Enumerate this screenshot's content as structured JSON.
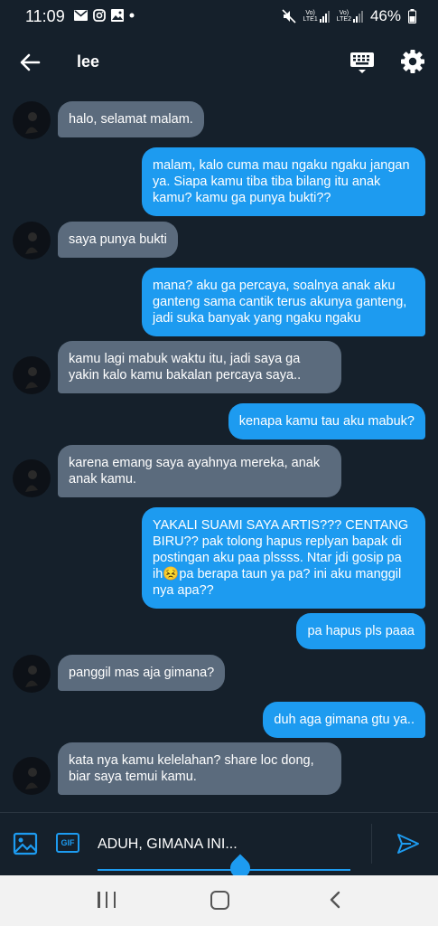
{
  "status_bar": {
    "time": "11:09",
    "lte1": "LTE1",
    "lte2": "LTE2",
    "volte1": "Vo)",
    "volte2": "Vo)",
    "battery": "46%"
  },
  "header": {
    "title": "lee"
  },
  "messages": [
    {
      "from": "them",
      "text": "halo, selamat malam."
    },
    {
      "from": "me",
      "text": "malam, kalo cuma mau ngaku ngaku jangan ya. Siapa kamu tiba tiba bilang itu anak kamu? kamu ga punya bukti??"
    },
    {
      "from": "them",
      "text": "saya punya bukti"
    },
    {
      "from": "me",
      "text": "mana? aku ga percaya, soalnya anak aku ganteng sama cantik terus akunya ganteng, jadi suka banyak yang ngaku ngaku"
    },
    {
      "from": "them",
      "text": "kamu lagi mabuk waktu itu, jadi saya ga yakin kalo kamu bakalan percaya saya.."
    },
    {
      "from": "me",
      "text": "kenapa kamu tau aku mabuk?"
    },
    {
      "from": "them",
      "text": "karena emang saya ayahnya mereka, anak anak kamu."
    },
    {
      "from": "me",
      "text": "YAKALI SUAMI SAYA ARTIS??? CENTANG BIRU?? pak tolong hapus replyan bapak di postingan aku paa plssss. Ntar jdi gosip pa ih😣pa berapa taun ya pa? ini aku manggil nya apa??"
    },
    {
      "from": "me",
      "text": "pa hapus pls paaa"
    },
    {
      "from": "them",
      "text": "panggil mas aja gimana?"
    },
    {
      "from": "me",
      "text": "duh aga gimana gtu ya.."
    },
    {
      "from": "them",
      "text": "kata nya kamu kelelahan? share loc dong, biar saya temui kamu."
    }
  ],
  "composer": {
    "value": "ADUH, GIMANA INI...",
    "gif_label": "GIF"
  },
  "colors": {
    "background": "#15202b",
    "outgoing": "#1d9bf0",
    "incoming": "#5b6b7d"
  },
  "icons": [
    "back-arrow-icon",
    "keyboard-icon",
    "gear-icon",
    "image-icon",
    "gif-icon",
    "send-icon",
    "mail-icon",
    "instagram-icon",
    "gallery-icon",
    "mute-icon",
    "battery-icon"
  ]
}
